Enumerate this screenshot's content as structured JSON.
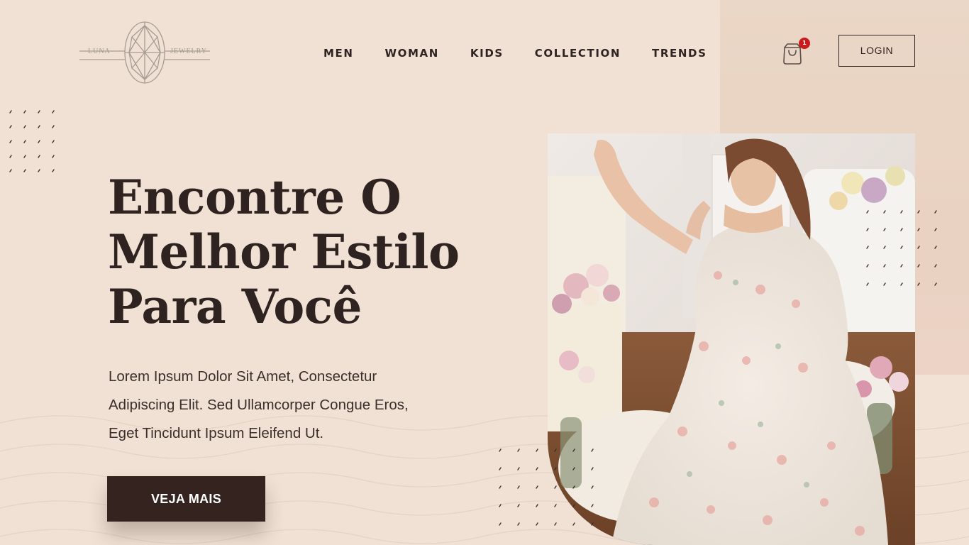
{
  "brand": {
    "left_word": "LUNA",
    "right_word": "JEWELRY",
    "logo_icon": "diamond-icon"
  },
  "nav": {
    "items": [
      {
        "label": "MEN"
      },
      {
        "label": "WOMAN"
      },
      {
        "label": "KIDS"
      },
      {
        "label": "COLLECTION"
      },
      {
        "label": "TRENDS"
      }
    ]
  },
  "cart": {
    "icon": "shopping-bag-icon",
    "count": "1",
    "badge_color": "#cc1b1b"
  },
  "login": {
    "label": "LOGIN"
  },
  "hero": {
    "title_lines": [
      "Encontre O",
      "Melhor Estilo",
      "Para Você"
    ],
    "description_lines": [
      "Lorem Ipsum Dolor Sit Amet, Consectetur",
      "Adipiscing Elit. Sed Ullamcorper Congue Eros,",
      "Eget Tincidunt Ipsum Eleifend Ut."
    ],
    "cta_label": "VEJA MAIS"
  },
  "colors": {
    "background": "#f0e1d4",
    "text_dark": "#2e2320",
    "button_dark": "#35231f"
  }
}
